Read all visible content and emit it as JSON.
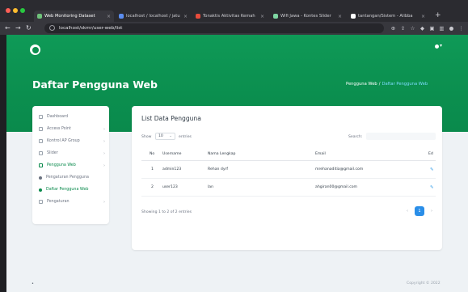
{
  "browser": {
    "tabs": [
      {
        "title": "Web Monitoring Dataset",
        "color": "#6fc27a",
        "active": true
      },
      {
        "title": "localhost / localhost / jatu",
        "color": "#5b8def",
        "active": false
      },
      {
        "title": "Tonaktis Aktivitas Kemah",
        "color": "#e74c3c",
        "active": false
      },
      {
        "title": "Wifi Jawa - Kontes Slider",
        "color": "#7ed6a2",
        "active": false
      },
      {
        "title": "tantangan/Sistem - Alibba",
        "color": "#ffffff",
        "active": false
      }
    ],
    "url": "localhost/skmr/user-web/list"
  },
  "hero": {
    "title": "Daftar Pengguna Web",
    "breadcrumb_parent": "Pengguna Web",
    "breadcrumb_separator": "/",
    "breadcrumb_current": "Daftar Pengguna Web"
  },
  "sidebar": {
    "items": [
      {
        "label": "Dashboard",
        "caret": ""
      },
      {
        "label": "Access Point",
        "caret": "›"
      },
      {
        "label": "Kontrol AP Group",
        "caret": "›"
      },
      {
        "label": "Slider",
        "caret": "›"
      },
      {
        "label": "Pengguna Web",
        "caret": "›"
      },
      {
        "label": "Pengaturan Pengguna",
        "caret": ""
      },
      {
        "label": "Daftar Pengguna Web",
        "caret": ""
      },
      {
        "label": "Pengaturan",
        "caret": "›"
      }
    ]
  },
  "card": {
    "title": "List Data Pengguna",
    "show_label": "Show",
    "show_value": "10",
    "entries_label": "entries",
    "search_label": "Search:",
    "columns": [
      "No",
      "Username",
      "Nama Lengkap",
      "Email",
      "Ed"
    ],
    "rows": [
      {
        "no": "1",
        "username": "admin123",
        "fullname": "Rehan dyrf",
        "email": "mrehanaditia@gmail.com"
      },
      {
        "no": "2",
        "username": "user123",
        "fullname": "lan",
        "email": "ahgiran00@gmail.com"
      }
    ],
    "info": "Showing 1 to 2 of 2 entries",
    "pagination": [
      "‹",
      "1",
      "›"
    ]
  },
  "footer": {
    "text": "Copyright © 2022"
  }
}
